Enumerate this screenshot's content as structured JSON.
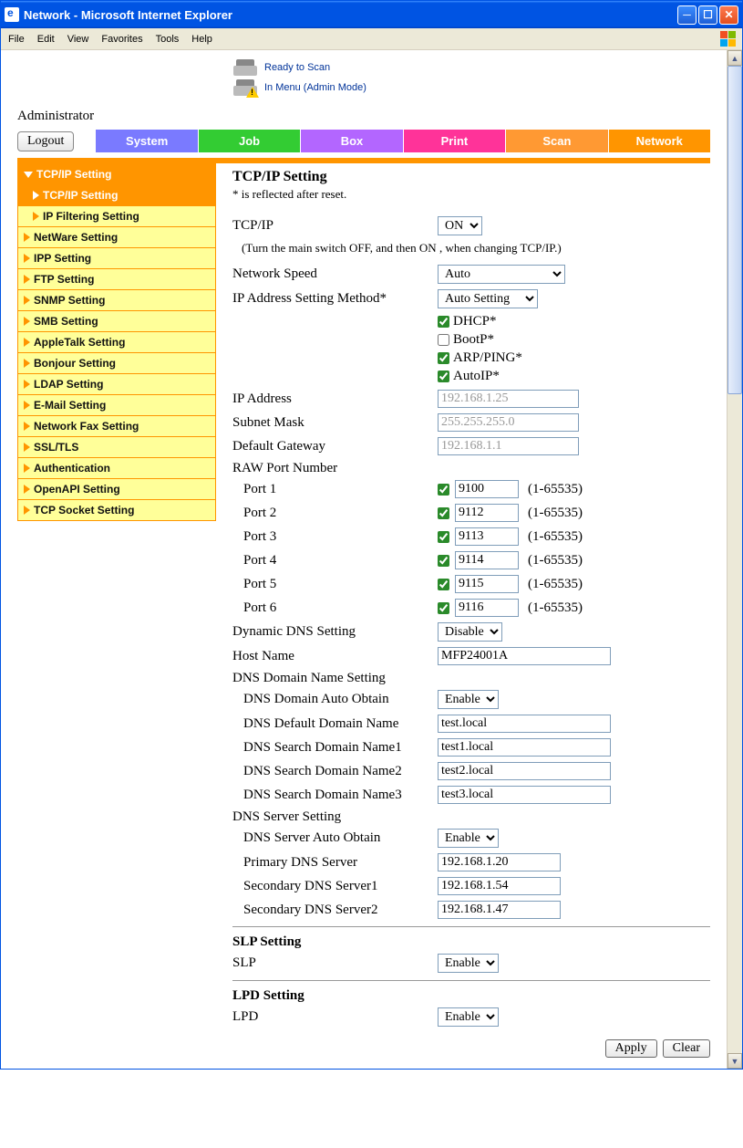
{
  "window": {
    "title": "Network - Microsoft Internet Explorer"
  },
  "menubar": [
    "File",
    "Edit",
    "View",
    "Favorites",
    "Tools",
    "Help"
  ],
  "status": {
    "ready": "Ready to Scan",
    "menu": "In Menu (Admin Mode)"
  },
  "admin_label": "Administrator",
  "logout": "Logout",
  "tabs": {
    "system": "System",
    "job": "Job",
    "box": "Box",
    "print": "Print",
    "scan": "Scan",
    "network": "Network"
  },
  "sidebar": {
    "header": "TCP/IP Setting",
    "sub1": "TCP/IP Setting",
    "sub2": "IP Filtering Setting",
    "items": [
      "NetWare Setting",
      "IPP Setting",
      "FTP Setting",
      "SNMP Setting",
      "SMB Setting",
      "AppleTalk Setting",
      "Bonjour Setting",
      "LDAP Setting",
      "E-Mail Setting",
      "Network Fax Setting",
      "SSL/TLS",
      "Authentication",
      "OpenAPI Setting",
      "TCP Socket Setting"
    ]
  },
  "form": {
    "title": "TCP/IP Setting",
    "note": "* is reflected after reset.",
    "tcpip_label": "TCP/IP",
    "tcpip_value": "ON",
    "tcpip_hint": "(Turn the main switch OFF, and then ON , when changing TCP/IP.)",
    "speed_label": "Network Speed",
    "speed_value": "Auto",
    "method_label": "IP Address Setting Method*",
    "method_value": "Auto Setting",
    "checks": {
      "dhcp": "DHCP*",
      "bootp": "BootP*",
      "arp": "ARP/PING*",
      "autoip": "AutoIP*"
    },
    "ip_label": "IP Address",
    "ip_value": "192.168.1.25",
    "mask_label": "Subnet Mask",
    "mask_value": "255.255.255.0",
    "gw_label": "Default Gateway",
    "gw_value": "192.168.1.1",
    "raw_header": "RAW Port Number",
    "ports": [
      {
        "label": "Port 1",
        "val": "9100"
      },
      {
        "label": "Port 2",
        "val": "9112"
      },
      {
        "label": "Port 3",
        "val": "9113"
      },
      {
        "label": "Port 4",
        "val": "9114"
      },
      {
        "label": "Port 5",
        "val": "9115"
      },
      {
        "label": "Port 6",
        "val": "9116"
      }
    ],
    "port_range": "(1-65535)",
    "ddns_label": "Dynamic DNS Setting",
    "ddns_value": "Disable",
    "host_label": "Host Name",
    "host_value": "MFP24001A",
    "dns_domain_header": "DNS Domain Name Setting",
    "dns_auto_label": "DNS Domain Auto Obtain",
    "dns_auto_value": "Enable",
    "dns_default_label": "DNS Default Domain Name",
    "dns_default_value": "test.local",
    "dns_s1_label": "DNS Search Domain Name1",
    "dns_s1_value": "test1.local",
    "dns_s2_label": "DNS Search Domain Name2",
    "dns_s2_value": "test2.local",
    "dns_s3_label": "DNS Search Domain Name3",
    "dns_s3_value": "test3.local",
    "dns_server_header": "DNS Server Setting",
    "dns_srv_auto_label": "DNS Server Auto Obtain",
    "dns_srv_auto_value": "Enable",
    "dns_primary_label": "Primary DNS Server",
    "dns_primary_value": "192.168.1.20",
    "dns_sec1_label": "Secondary DNS Server1",
    "dns_sec1_value": "192.168.1.54",
    "dns_sec2_label": "Secondary DNS Server2",
    "dns_sec2_value": "192.168.1.47",
    "slp_header": "SLP Setting",
    "slp_label": "SLP",
    "slp_value": "Enable",
    "lpd_header": "LPD Setting",
    "lpd_label": "LPD",
    "lpd_value": "Enable",
    "apply": "Apply",
    "clear": "Clear"
  }
}
